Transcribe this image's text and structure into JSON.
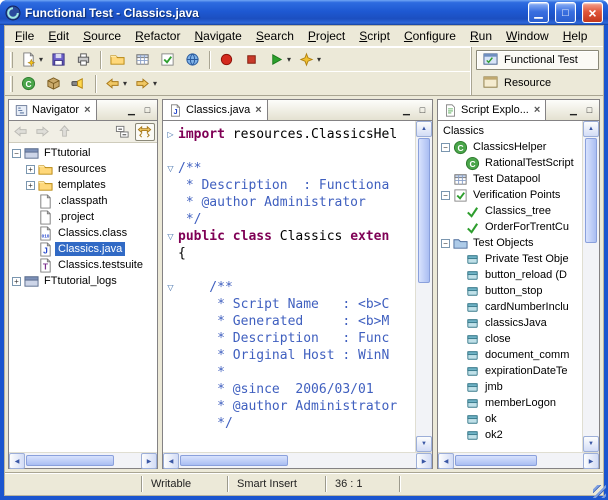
{
  "window": {
    "title": "Functional Test - Classics.java"
  },
  "colors": {
    "titlebar_blue": "#1b55cf",
    "selection_blue": "#316ac5",
    "keyword_purple": "#7f0055",
    "javadoc_blue": "#3f5fbf",
    "record_red": "#d42a1e",
    "helper_green": "#4aa54a"
  },
  "menubar": {
    "items": [
      {
        "label": "File"
      },
      {
        "label": "Edit"
      },
      {
        "label": "Source"
      },
      {
        "label": "Refactor"
      },
      {
        "label": "Navigate"
      },
      {
        "label": "Search"
      },
      {
        "label": "Project"
      },
      {
        "label": "Script"
      },
      {
        "label": "Configure"
      },
      {
        "label": "Run"
      },
      {
        "label": "Window"
      },
      {
        "label": "Help"
      }
    ]
  },
  "toolbar": {
    "row1": [
      {
        "icon": "new-wizard",
        "dropdown": true
      },
      {
        "icon": "save"
      },
      {
        "icon": "print"
      },
      {
        "type": "sep"
      },
      {
        "icon": "new-folder"
      },
      {
        "icon": "datapool"
      },
      {
        "icon": "insert-vp"
      },
      {
        "icon": "globe"
      },
      {
        "type": "sep"
      },
      {
        "icon": "record"
      },
      {
        "icon": "stop"
      },
      {
        "icon": "play",
        "dropdown": true
      },
      {
        "icon": "debug",
        "dropdown": true
      }
    ],
    "row2": [
      {
        "icon": "new-class"
      },
      {
        "icon": "new-package"
      },
      {
        "icon": "search"
      },
      {
        "type": "sep"
      },
      {
        "icon": "back",
        "dropdown": true
      },
      {
        "icon": "forward",
        "dropdown": true
      }
    ]
  },
  "perspectives": {
    "items": [
      {
        "label": "Functional Test",
        "icon": "ft-persp",
        "active": true
      },
      {
        "label": "Resource",
        "icon": "res-persp",
        "active": false
      }
    ]
  },
  "navigator": {
    "tab": "Navigator",
    "toolbar": [
      "back",
      "forward",
      "up",
      "collapse-all",
      "link-editor"
    ],
    "tree": [
      {
        "label": "FTtutorial",
        "icon": "project",
        "level": 0,
        "expander": "minus"
      },
      {
        "label": "resources",
        "icon": "folder",
        "level": 1,
        "expander": "plus"
      },
      {
        "label": "templates",
        "icon": "folder",
        "level": 1,
        "expander": "plus"
      },
      {
        "label": ".classpath",
        "icon": "file",
        "level": 1
      },
      {
        "label": ".project",
        "icon": "file",
        "level": 1
      },
      {
        "label": "Classics.class",
        "icon": "class-file",
        "level": 1
      },
      {
        "label": "Classics.java",
        "icon": "java-file",
        "level": 1,
        "selected": true
      },
      {
        "label": "Classics.testsuite",
        "icon": "testsuite-file",
        "level": 1
      },
      {
        "label": "FTtutorial_logs",
        "icon": "project",
        "level": 0,
        "expander": "plus"
      }
    ]
  },
  "editor": {
    "tab": "Classics.java",
    "lines": [
      {
        "fold": "collapsed",
        "segments": [
          {
            "text": "import",
            "style": "kw"
          },
          {
            "text": " resources.ClassicsHel",
            "style": "plain"
          }
        ]
      },
      {
        "segments": []
      },
      {
        "fold": "expanded",
        "segments": [
          {
            "text": "/**",
            "style": "doc"
          }
        ]
      },
      {
        "segments": [
          {
            "text": " * Description  : Functiona",
            "style": "doc"
          }
        ]
      },
      {
        "segments": [
          {
            "text": " * @author Administrator",
            "style": "doc"
          }
        ]
      },
      {
        "segments": [
          {
            "text": " */",
            "style": "doc"
          }
        ]
      },
      {
        "fold": "expanded",
        "segments": [
          {
            "text": "public class ",
            "style": "kw"
          },
          {
            "text": "Classics ",
            "style": "plain"
          },
          {
            "text": "exten",
            "style": "kw"
          }
        ]
      },
      {
        "segments": [
          {
            "text": "{",
            "style": "plain"
          }
        ]
      },
      {
        "segments": []
      },
      {
        "fold": "expanded",
        "segments": [
          {
            "text": "    /**",
            "style": "doc"
          }
        ]
      },
      {
        "segments": [
          {
            "text": "     * Script Name   : <b>C",
            "style": "doc"
          }
        ]
      },
      {
        "segments": [
          {
            "text": "     * Generated     : <b>M",
            "style": "doc"
          }
        ]
      },
      {
        "segments": [
          {
            "text": "     * Description   : Func",
            "style": "doc"
          }
        ]
      },
      {
        "segments": [
          {
            "text": "     * Original Host : WinN",
            "style": "doc"
          }
        ]
      },
      {
        "segments": [
          {
            "text": "     *",
            "style": "doc"
          }
        ]
      },
      {
        "segments": [
          {
            "text": "     * @since  2006/03/01",
            "style": "doc"
          }
        ]
      },
      {
        "segments": [
          {
            "text": "     * @author Administrator",
            "style": "doc"
          }
        ]
      },
      {
        "segments": [
          {
            "text": "     */",
            "style": "doc"
          }
        ]
      }
    ]
  },
  "script_explorer": {
    "tab": "Script Explo...",
    "root_label": "Classics",
    "tree": [
      {
        "label": "ClassicsHelper",
        "icon": "helper-class",
        "level": 0,
        "expander": "minus"
      },
      {
        "label": "RationalTestScript",
        "icon": "helper-class",
        "level": 1
      },
      {
        "label": "Test Datapool",
        "icon": "datapool",
        "level": 0
      },
      {
        "label": "Verification Points",
        "icon": "vp-folder",
        "level": 0,
        "expander": "minus"
      },
      {
        "label": "Classics_tree",
        "icon": "vp-check",
        "level": 1
      },
      {
        "label": "OrderForTrentCu",
        "icon": "vp-check",
        "level": 1
      },
      {
        "label": "Test Objects",
        "icon": "testobj-folder",
        "level": 0,
        "expander": "minus"
      },
      {
        "label": "Private Test Obje",
        "icon": "test-object",
        "level": 1
      },
      {
        "label": "button_reload (D",
        "icon": "test-object",
        "level": 1
      },
      {
        "label": "button_stop",
        "icon": "test-object",
        "level": 1
      },
      {
        "label": "cardNumberInclu",
        "icon": "test-object",
        "level": 1
      },
      {
        "label": "classicsJava",
        "icon": "test-object",
        "level": 1
      },
      {
        "label": "close",
        "icon": "test-object",
        "level": 1
      },
      {
        "label": "document_comm",
        "icon": "test-object",
        "level": 1
      },
      {
        "label": "expirationDateTe",
        "icon": "test-object",
        "level": 1
      },
      {
        "label": "jmb",
        "icon": "test-object",
        "level": 1
      },
      {
        "label": "memberLogon",
        "icon": "test-object",
        "level": 1
      },
      {
        "label": "ok",
        "icon": "test-object",
        "level": 1
      },
      {
        "label": "ok2",
        "icon": "test-object",
        "level": 1
      }
    ]
  },
  "statusbar": {
    "writable": "Writable",
    "insert_mode": "Smart Insert",
    "cursor_position": "36 : 1"
  }
}
